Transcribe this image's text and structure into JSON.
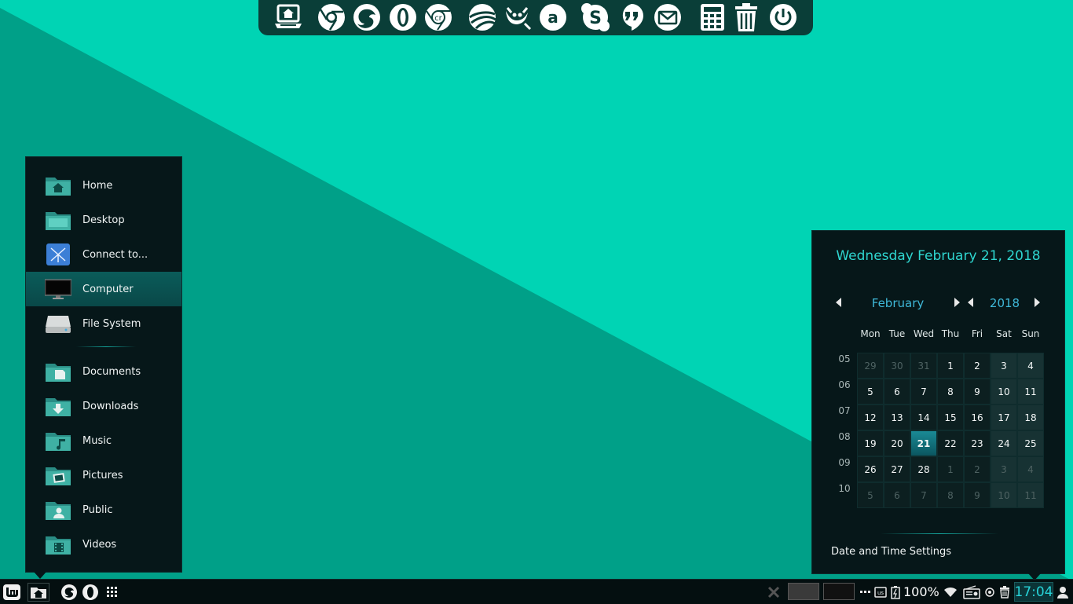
{
  "wallpaper": {
    "light": "#00d4b4",
    "dark": "#00a088"
  },
  "dock": {
    "background": "#0a3e38",
    "icons": [
      {
        "name": "home-laptop-icon"
      },
      {
        "name": "chromium-icon"
      },
      {
        "name": "firefox-icon"
      },
      {
        "name": "opera-icon"
      },
      {
        "name": "chrome-os-icon"
      },
      {
        "name": "google-earth-icon"
      },
      {
        "name": "gimp-icon"
      },
      {
        "name": "amazon-icon"
      },
      {
        "name": "skype-icon"
      },
      {
        "name": "hangouts-icon"
      },
      {
        "name": "mail-icon"
      },
      {
        "name": "calculator-icon"
      },
      {
        "name": "trash-icon"
      },
      {
        "name": "power-icon"
      }
    ]
  },
  "places": {
    "items": [
      {
        "label": "Home",
        "icon": "home-folder-icon"
      },
      {
        "label": "Desktop",
        "icon": "desktop-folder-icon"
      },
      {
        "label": "Connect to...",
        "icon": "network-icon"
      },
      {
        "label": "Computer",
        "icon": "monitor-icon",
        "active": true
      },
      {
        "label": "File System",
        "icon": "drive-icon"
      }
    ],
    "folders": [
      {
        "label": "Documents",
        "icon": "documents-folder-icon"
      },
      {
        "label": "Downloads",
        "icon": "downloads-folder-icon"
      },
      {
        "label": "Music",
        "icon": "music-folder-icon"
      },
      {
        "label": "Pictures",
        "icon": "pictures-folder-icon"
      },
      {
        "label": "Public",
        "icon": "public-folder-icon"
      },
      {
        "label": "Videos",
        "icon": "videos-folder-icon"
      }
    ]
  },
  "calendar": {
    "date_heading": "Wednesday February 21, 2018",
    "month": "February",
    "year": "2018",
    "day_names": [
      "Mon",
      "Tue",
      "Wed",
      "Thu",
      "Fri",
      "Sat",
      "Sun"
    ],
    "week_numbers": [
      "05",
      "06",
      "07",
      "08",
      "09",
      "10"
    ],
    "weeks": [
      [
        {
          "d": "29",
          "o": true
        },
        {
          "d": "30",
          "o": true
        },
        {
          "d": "31",
          "o": true
        },
        {
          "d": "1"
        },
        {
          "d": "2"
        },
        {
          "d": "3"
        },
        {
          "d": "4"
        }
      ],
      [
        {
          "d": "5"
        },
        {
          "d": "6"
        },
        {
          "d": "7"
        },
        {
          "d": "8"
        },
        {
          "d": "9"
        },
        {
          "d": "10"
        },
        {
          "d": "11"
        }
      ],
      [
        {
          "d": "12"
        },
        {
          "d": "13"
        },
        {
          "d": "14"
        },
        {
          "d": "15"
        },
        {
          "d": "16"
        },
        {
          "d": "17"
        },
        {
          "d": "18"
        }
      ],
      [
        {
          "d": "19"
        },
        {
          "d": "20"
        },
        {
          "d": "21",
          "t": true
        },
        {
          "d": "22"
        },
        {
          "d": "23"
        },
        {
          "d": "24"
        },
        {
          "d": "25"
        }
      ],
      [
        {
          "d": "26"
        },
        {
          "d": "27"
        },
        {
          "d": "28"
        },
        {
          "d": "1",
          "o": true
        },
        {
          "d": "2",
          "o": true
        },
        {
          "d": "3",
          "o": true
        },
        {
          "d": "4",
          "o": true
        }
      ],
      [
        {
          "d": "5",
          "o": true
        },
        {
          "d": "6",
          "o": true
        },
        {
          "d": "7",
          "o": true
        },
        {
          "d": "8",
          "o": true
        },
        {
          "d": "9",
          "o": true
        },
        {
          "d": "10",
          "o": true
        },
        {
          "d": "11",
          "o": true
        }
      ]
    ],
    "settings_label": "Date and Time Settings",
    "accent": "#2fd6d0"
  },
  "panel": {
    "battery": "100%",
    "clock": "17:04",
    "left_icons": [
      "mint-menu-icon",
      "home-folder-icon",
      "firefox-icon",
      "opera-icon",
      "app-grid-icon"
    ],
    "tray_icons": [
      "x-icon",
      "more-dots-icon",
      "keyboard-icon",
      "battery-icon",
      "wifi-icon",
      "radio-icon",
      "media-icon",
      "trash-icon",
      "user-icon"
    ]
  }
}
